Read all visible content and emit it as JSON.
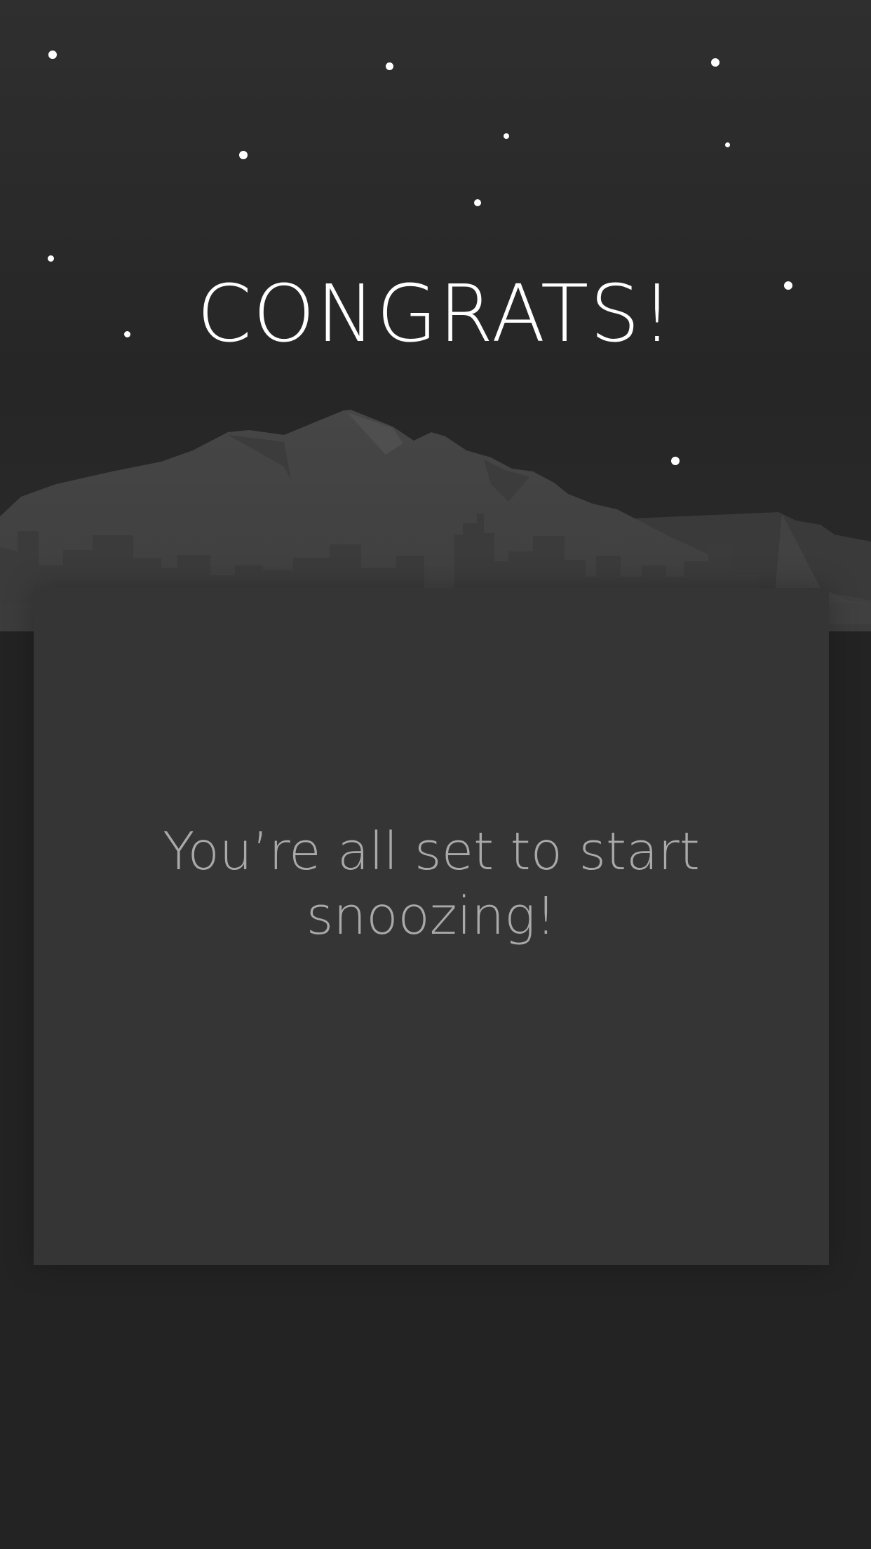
{
  "header": {
    "title": "CONGRATS!"
  },
  "card": {
    "message": "You’re all set to start snoozing!"
  },
  "scene": {
    "background_color": "#232323",
    "card_color": "#353535",
    "mountain_color": "#474747",
    "skyline_color": "#3a3a3a",
    "star_color": "#ffffff"
  }
}
